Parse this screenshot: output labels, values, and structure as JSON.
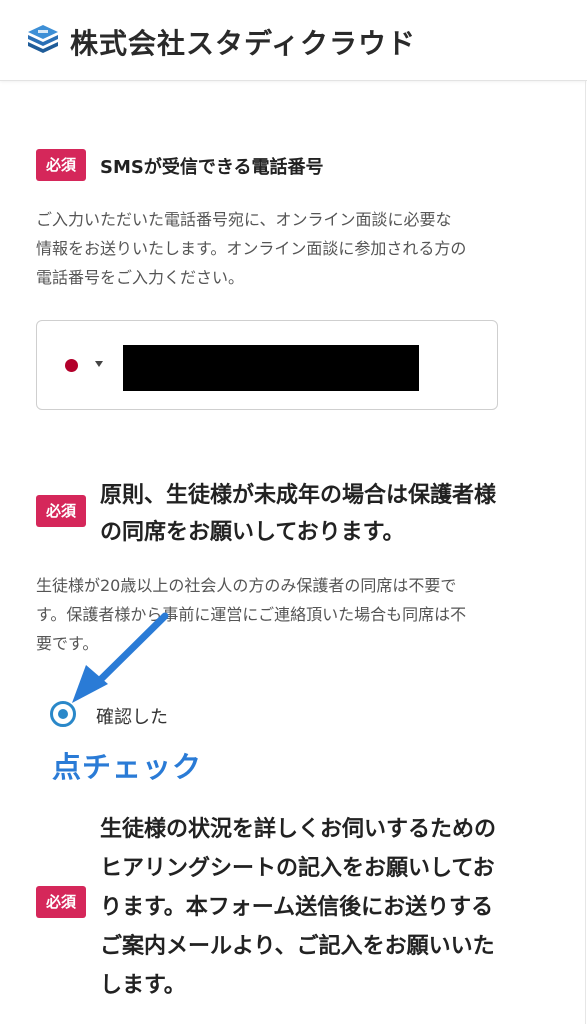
{
  "header": {
    "brand_name": "株式会社スタディクラウド",
    "logo_icon": "stacked-books-icon"
  },
  "colors": {
    "required_badge": "#d5275a",
    "radio_accent": "#2a88c9",
    "annotation": "#2a7bd6"
  },
  "sections": [
    {
      "badge": "必須",
      "title": "SMSが受信できる電話番号",
      "description_lines": [
        "ご入力いただいた電話番号宛に、オンライン面談に必要な",
        "情報をお送りいたします。オンライン面談に参加される方の",
        "電話番号をご入力ください。"
      ],
      "phone": {
        "country_icon": "japan-flag-icon",
        "value": ""
      }
    },
    {
      "badge": "必須",
      "title_lines": [
        "原則、生徒様が未成年の場合は保護者様",
        "の同席をお願いしております。"
      ],
      "description_lines": [
        "生徒様が20歳以上の社会人の方のみ保護者の同席は不要で",
        "す。保護者様から事前に運営にご連絡頂いた場合も同席は不",
        "要です。"
      ],
      "radio_label": "確認した",
      "radio_checked": true
    },
    {
      "badge": "必須",
      "title_lines": [
        "生徒様の状況を詳しくお伺いするための",
        "ヒアリングシートの記入をお願いしてお",
        "ります。本フォーム送信後にお送りする",
        "ご案内メールより、ご記入をお願いいた",
        "します。"
      ]
    }
  ],
  "annotation": {
    "text": "点チェック",
    "arrow_icon": "pointer-arrow-icon"
  }
}
